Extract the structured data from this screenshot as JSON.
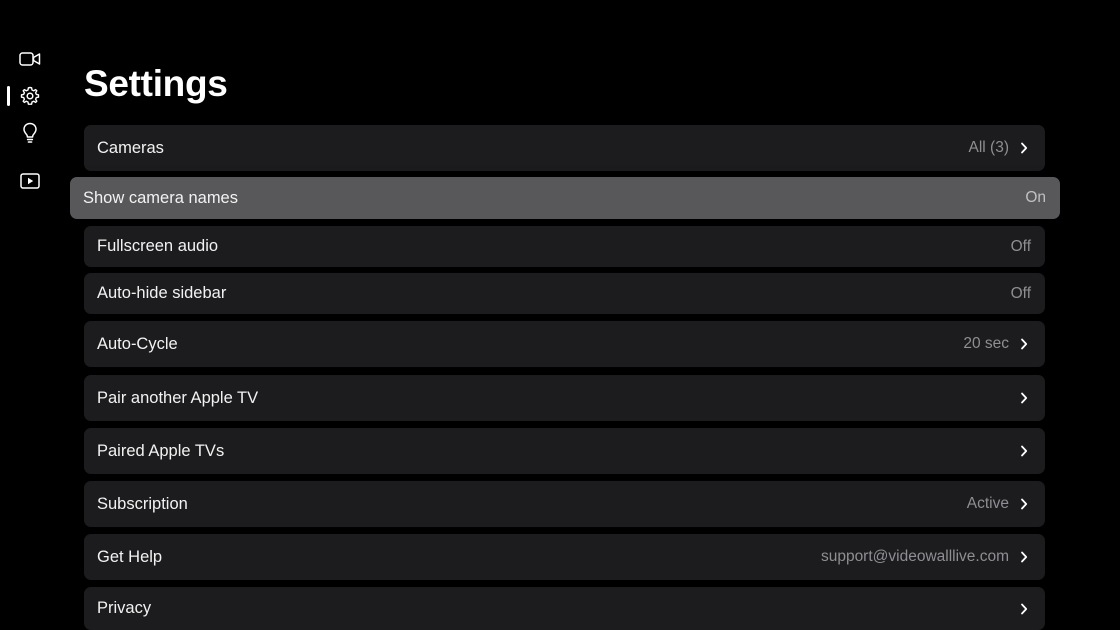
{
  "page": {
    "title": "Settings"
  },
  "sidebar": {
    "items": [
      {
        "icon": "video-camera-icon",
        "selected": false
      },
      {
        "icon": "gear-icon",
        "selected": true
      },
      {
        "icon": "lightbulb-icon",
        "selected": false
      },
      {
        "icon": "play-icon",
        "selected": false
      }
    ]
  },
  "settings": {
    "rows": [
      {
        "label": "Cameras",
        "value": "All (3)",
        "chevron": true
      },
      {
        "label": "Show camera names",
        "value": "On",
        "chevron": false,
        "focused": true
      },
      {
        "label": "Fullscreen audio",
        "value": "Off",
        "chevron": false
      },
      {
        "label": "Auto-hide sidebar",
        "value": "Off",
        "chevron": false
      },
      {
        "label": "Auto-Cycle",
        "value": "20 sec",
        "chevron": true
      },
      {
        "label": "Pair another Apple TV",
        "value": "",
        "chevron": true
      },
      {
        "label": "Paired Apple TVs",
        "value": "",
        "chevron": true
      },
      {
        "label": "Subscription",
        "value": "Active",
        "chevron": true
      },
      {
        "label": "Get Help",
        "value": "support@videowalllive.com",
        "chevron": true
      },
      {
        "label": "Privacy",
        "value": "",
        "chevron": true
      }
    ]
  },
  "colors": {
    "background": "#000000",
    "row": "#1c1c1e",
    "row_focused": "#58585a",
    "value_text": "#8e8e93"
  }
}
